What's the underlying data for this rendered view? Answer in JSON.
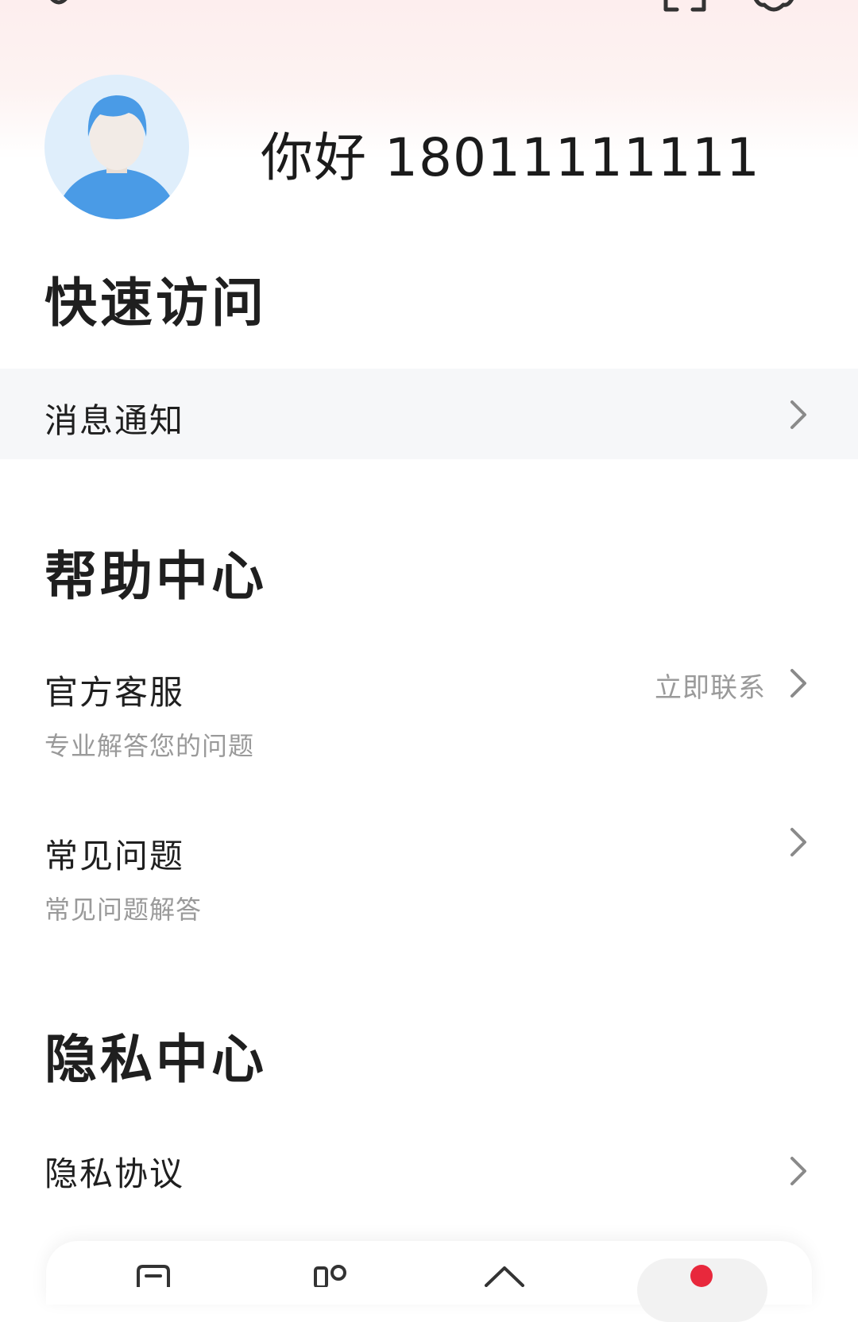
{
  "profile": {
    "greeting": "你好 18011111111"
  },
  "quick_access": {
    "title": "快速访问",
    "items": [
      {
        "label": "消息通知"
      }
    ]
  },
  "help_center": {
    "title": "帮助中心",
    "items": [
      {
        "label": "官方客服",
        "subtitle": "专业解答您的问题",
        "action": "立即联系"
      },
      {
        "label": "常见问题",
        "subtitle": "常见问题解答"
      }
    ]
  },
  "privacy_center": {
    "title": "隐私中心",
    "items": [
      {
        "label": "隐私协议"
      }
    ]
  },
  "colors": {
    "accent_red": "#e8283c",
    "highlight_row": "#f6f7f9",
    "avatar_blue": "#4a9be6"
  },
  "icons": {
    "top_left": "headset-icon",
    "top_right": [
      "scan-icon",
      "settings-icon"
    ],
    "row": "chevron-right-icon",
    "bottom_nav": [
      "bookmark-icon",
      "grid-icon",
      "home-icon",
      "profile-icon"
    ]
  }
}
